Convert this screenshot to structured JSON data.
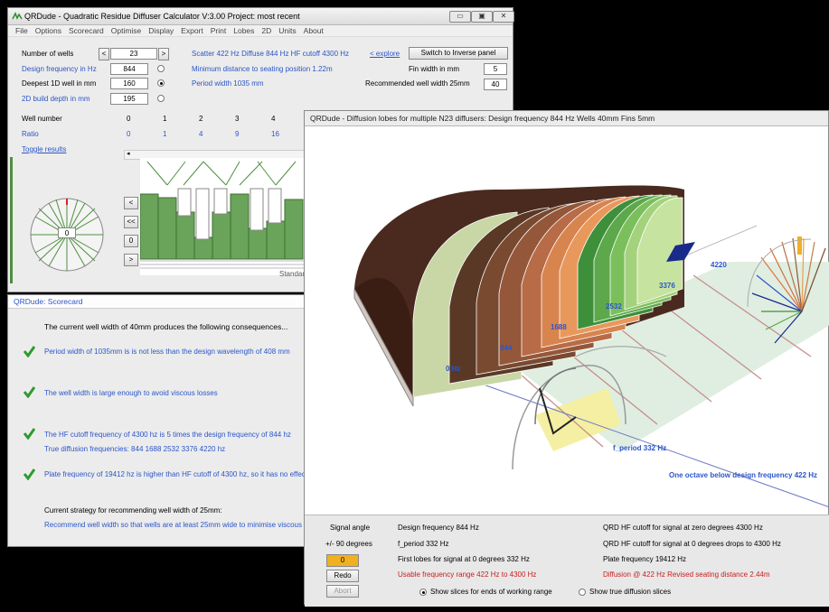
{
  "main": {
    "title": "QRDude - Quadratic Residue Diffuser Calculator  V:3.00  Project: most recent",
    "menu": [
      "File",
      "Options",
      "Scorecard",
      "Optimise",
      "Display",
      "Export",
      "Print",
      "Lobes",
      "2D",
      "Units",
      "About"
    ],
    "wells_label": "Number of wells",
    "wells_value": "23",
    "design_freq_label": "Design frequency in Hz",
    "design_freq_value": "844",
    "deepest_label": "Deepest 1D well in mm",
    "deepest_value": "160",
    "build_depth_label": "2D build depth in mm",
    "build_depth_value": "195",
    "scatter_info": "Scatter 422 Hz   Diffuse 844 Hz   HF cutoff 4300 Hz",
    "explore_link": "< explore",
    "switch_button": "Switch to Inverse panel",
    "min_distance": "Minimum distance to seating position 1.22m",
    "fin_label": "Fin width in mm",
    "fin_value": "5",
    "period_width": "Period width 1035 mm",
    "rec_well_label": "Recommended well width 25mm",
    "rec_well_value": "40",
    "well_number_label": "Well number",
    "well_numbers": [
      "0",
      "1",
      "2",
      "3",
      "4"
    ],
    "ratio_label": "Ratio",
    "ratios": [
      "0",
      "1",
      "4",
      "9",
      "16"
    ],
    "toggle_results": "Toggle results",
    "dial_value": "0",
    "nav_buttons": [
      "<",
      "<<",
      "0",
      ">"
    ],
    "standard_label": "Standar"
  },
  "scorecard": {
    "title": "QRDude: Scorecard",
    "intro": "The current well width of  40mm produces the following consequences...",
    "items": [
      "Period width of  1035mm is is not less than the design wavelength of  408 mm",
      "The well width is large enough to avoid viscous losses",
      "The HF cutoff frequency of  4300 hz is  5 times the design frequency of  844 hz",
      "Plate frequency of  19412 hz is higher than HF cutoff of  4300 hz, so it has no effect"
    ],
    "true_diffusion": "True diffusion frequencies:   844   1688   2532   3376   4220 hz",
    "strategy": "Current strategy for recommending well width of  25mm:",
    "strategy_detail": "Recommend well width so that wells are at least 25mm wide to minimise viscous losses"
  },
  "diffusion": {
    "title": "QRDude - Diffusion lobes for multiple N23 diffusers:  Design frequency  844 Hz    Wells  40mm    Fins 5mm",
    "freq_labels": [
      "0 Hz",
      "844",
      "1688",
      "2532",
      "3376",
      "4220"
    ],
    "fperiod_label": "f_period  332 Hz",
    "octave_label": "One octave below design frequency  422 Hz",
    "footer": {
      "signal_angle": "Signal angle",
      "angle_range": "+/- 90 degrees",
      "angle_value": "0",
      "redo": "Redo",
      "abort": "Abort",
      "design_freq": "Design frequency  844 Hz",
      "f_period": "f_period  332 Hz",
      "first_lobes": "First lobes for signal at  0 degrees  332 Hz",
      "usable_range": "Usable frequency range  422 Hz to  4300 Hz",
      "qrd_zero": "QRD HF cutoff for signal at zero degrees  4300 Hz",
      "qrd_drops": "QRD HF cutoff for signal at  0 degrees drops to  4300 Hz",
      "plate_freq": "Plate frequency   19412 Hz",
      "diffusion_note": "Diffusion @ 422 Hz Revised seating distance 2.44m",
      "radio_ends": "Show slices for ends of working range",
      "radio_true": "Show true diffusion slices"
    }
  },
  "colors": {
    "accent_blue": "#2c56c8",
    "warning_red": "#c81e1e",
    "green_check": "#2e9a2e",
    "bar_green": "#6aa35a"
  }
}
